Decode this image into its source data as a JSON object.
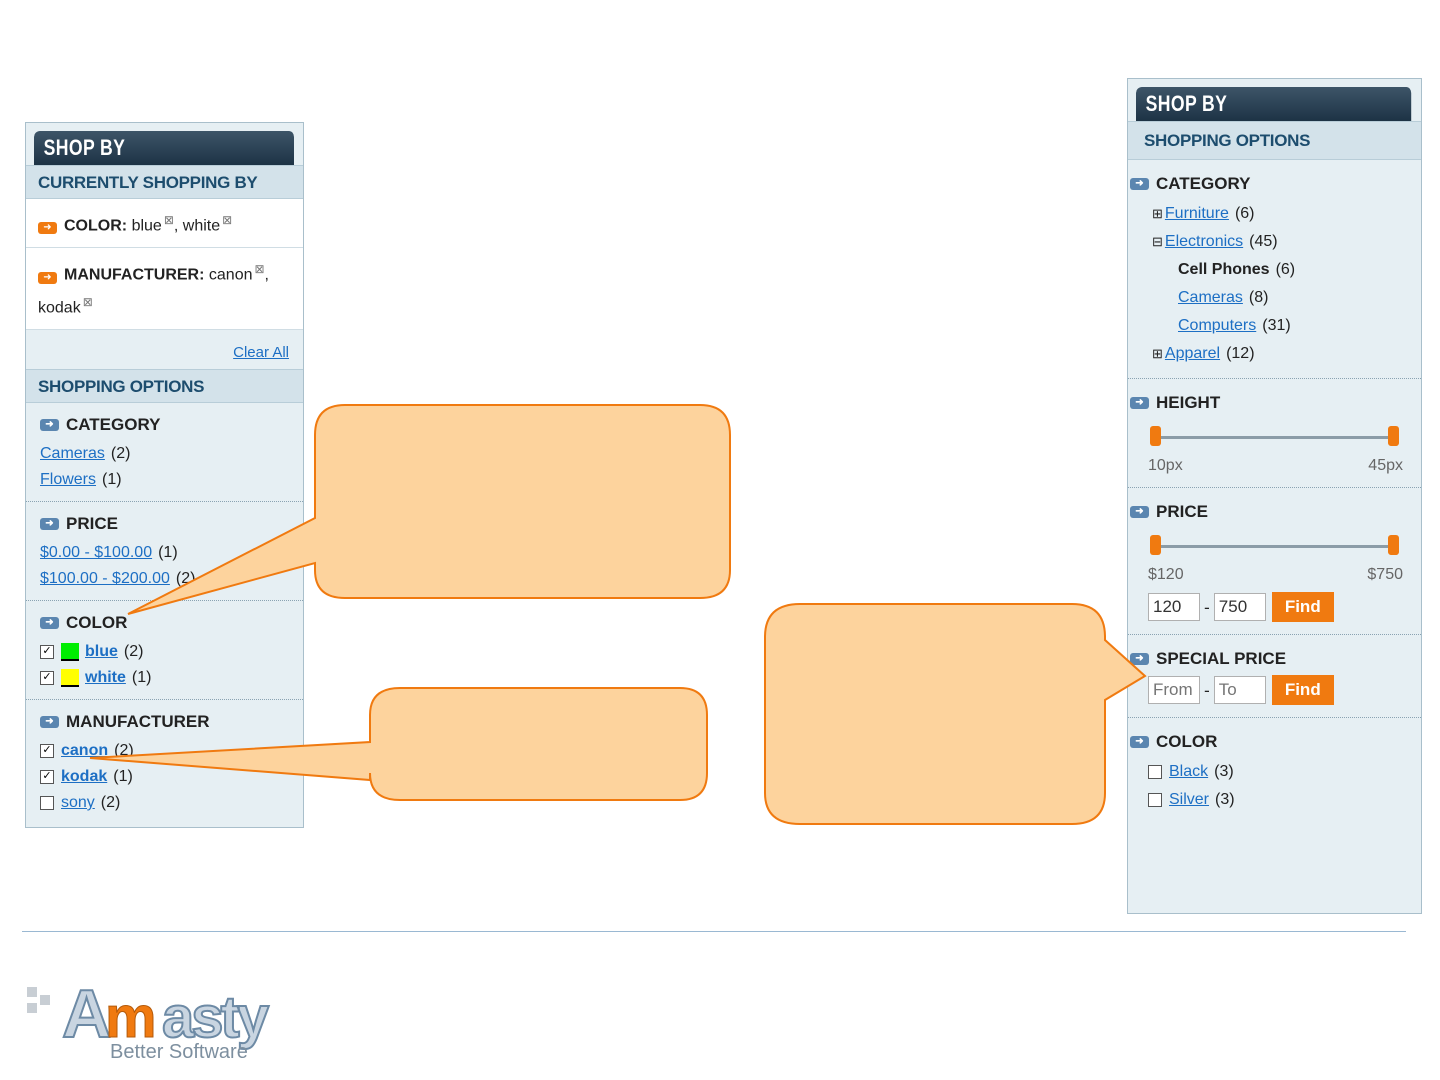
{
  "left_panel": {
    "header": "SHOP BY",
    "currently": {
      "title": "CURRENTLY SHOPPING BY",
      "filters": [
        {
          "label": "COLOR:",
          "values": [
            "blue",
            "white"
          ]
        },
        {
          "label": "MANUFACTURER:",
          "values": [
            "canon",
            "kodak"
          ]
        }
      ],
      "clear_all": "Clear All"
    },
    "options_title": "SHOPPING OPTIONS",
    "category": {
      "title": "CATEGORY",
      "items": [
        {
          "label": "Cameras",
          "count": "(2)"
        },
        {
          "label": "Flowers",
          "count": "(1)"
        }
      ]
    },
    "price": {
      "title": "PRICE",
      "items": [
        {
          "label": "$0.00 - $100.00",
          "count": "(1)"
        },
        {
          "label": "$100.00 - $200.00",
          "count": "(2)"
        }
      ]
    },
    "color": {
      "title": "COLOR",
      "items": [
        {
          "label": "blue",
          "count": "(2)",
          "swatch": "#00ee00",
          "checked": true
        },
        {
          "label": "white",
          "count": "(1)",
          "swatch": "#ffff00",
          "checked": true
        }
      ]
    },
    "manufacturer": {
      "title": "MANUFACTURER",
      "items": [
        {
          "label": "canon",
          "count": "(2)",
          "checked": true
        },
        {
          "label": "kodak",
          "count": "(1)",
          "checked": true
        },
        {
          "label": "sony",
          "count": "(2)",
          "checked": false
        }
      ]
    }
  },
  "right_panel": {
    "header": "SHOP BY",
    "options_title": "SHOPPING OPTIONS",
    "category": {
      "title": "CATEGORY",
      "items": [
        {
          "label": "Furniture",
          "count": "(6)",
          "toggle": "⊞"
        },
        {
          "label": "Electronics",
          "count": "(45)",
          "toggle": "⊟"
        },
        {
          "label": "Cell Phones",
          "count": "(6)",
          "current": true
        },
        {
          "label": "Cameras",
          "count": "(8)"
        },
        {
          "label": "Computers",
          "count": "(31)"
        },
        {
          "label": "Apparel",
          "count": "(12)",
          "toggle": "⊞"
        }
      ]
    },
    "height": {
      "title": "HEIGHT",
      "min_label": "10px",
      "max_label": "45px"
    },
    "price": {
      "title": "PRICE",
      "min_label": "$120",
      "max_label": "$750",
      "from_value": "120",
      "to_value": "750",
      "find": "Find"
    },
    "special_price": {
      "title": "SPECIAL PRICE",
      "from_placeholder": "From",
      "to_placeholder": "To",
      "find": "Find"
    },
    "color": {
      "title": "COLOR",
      "items": [
        {
          "label": "Black",
          "count": "(3)"
        },
        {
          "label": "Silver",
          "count": "(3)"
        }
      ]
    }
  },
  "logo": {
    "brand": "Amasty",
    "tagline": "Better Software"
  },
  "colors": {
    "accent": "#f07a10",
    "callout_fill": "#fdd39d",
    "callout_stroke": "#f07a10",
    "link": "#1d6fc4"
  }
}
